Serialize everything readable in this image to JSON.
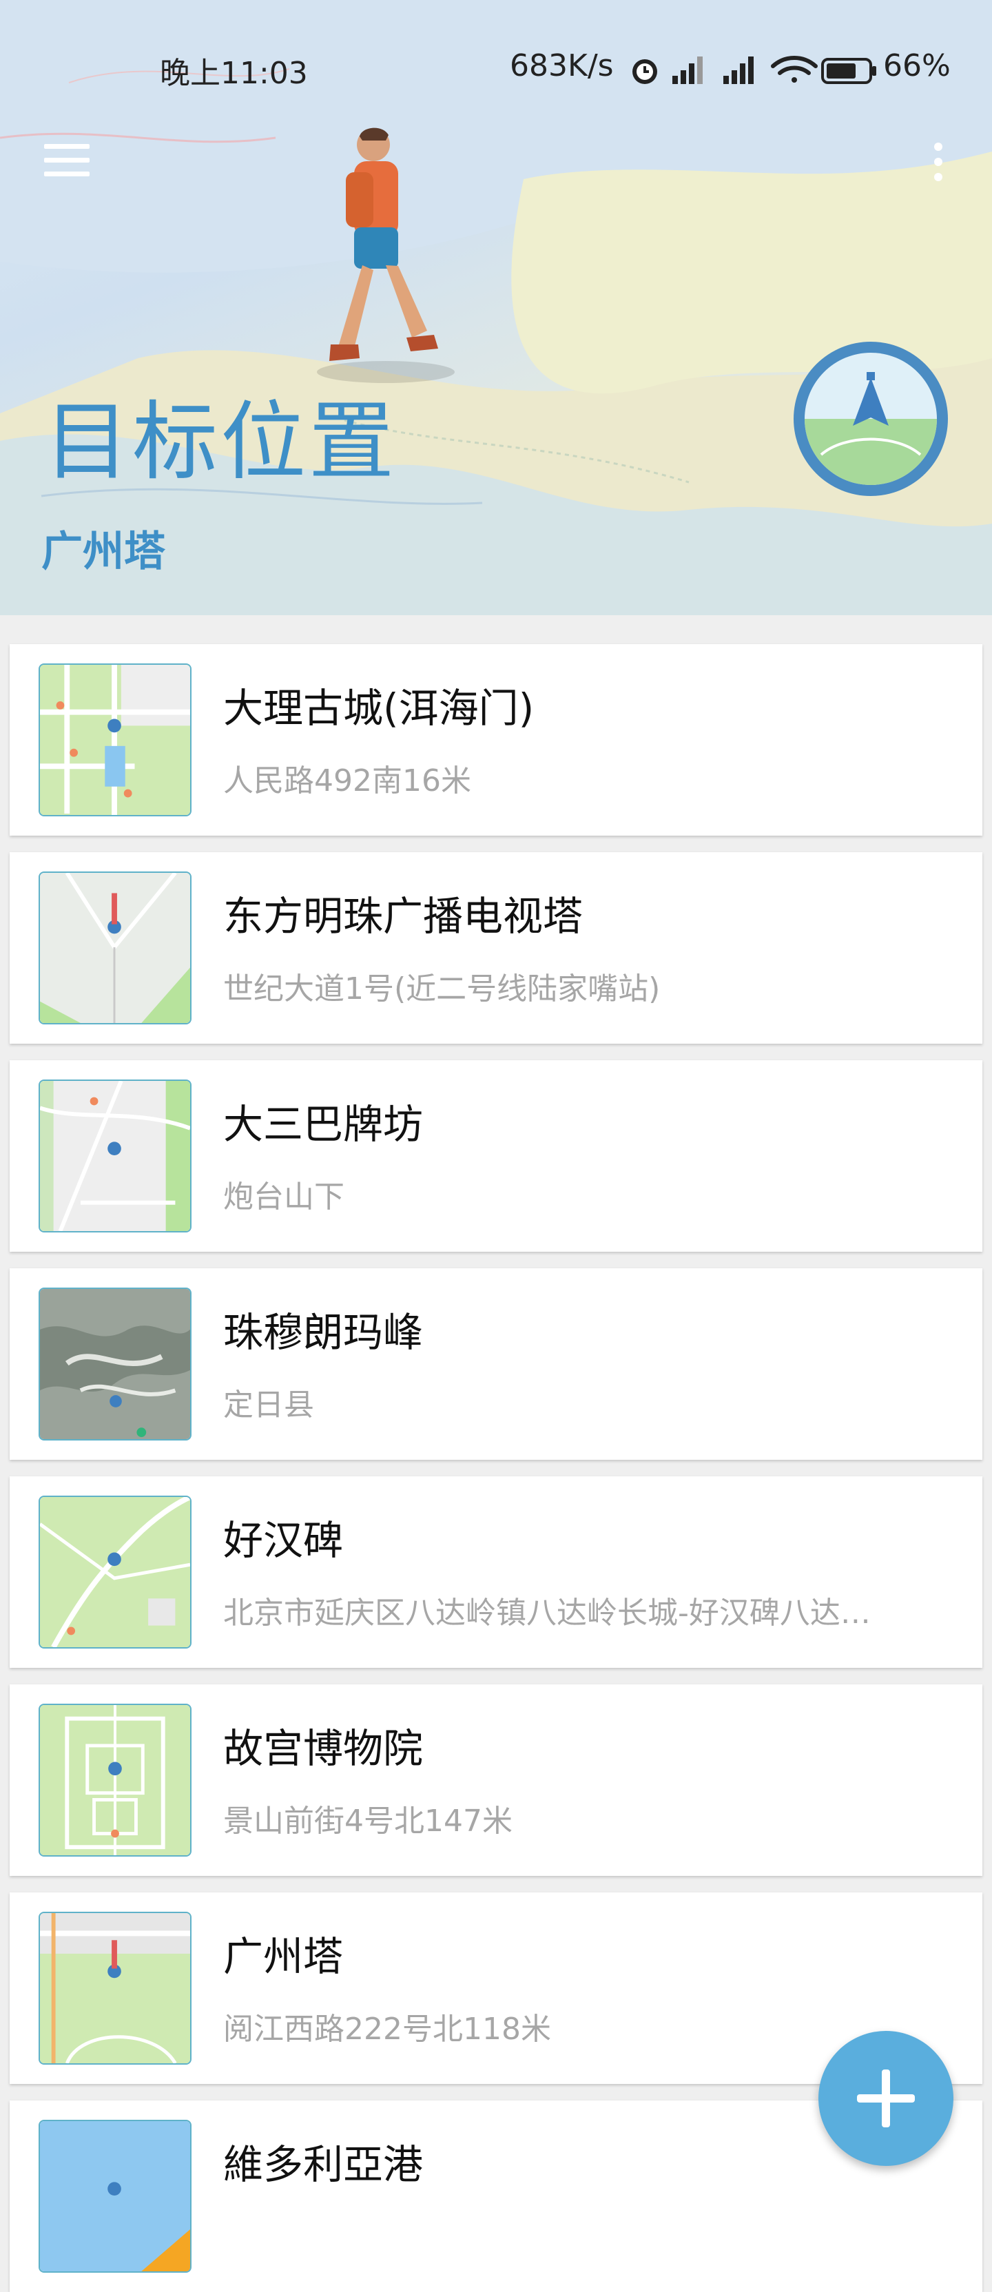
{
  "status_bar": {
    "time": "晚上11:03",
    "network_speed": "683K/s",
    "battery_percent": "66%"
  },
  "header": {
    "title": "目标位置",
    "subtitle": "广州塔",
    "menu_icon": "hamburger-menu-icon",
    "more_icon": "more-vertical-icon",
    "navigate_icon": "navigation-compass-icon",
    "accent_color": "#3e8fc7"
  },
  "places": [
    {
      "name": "大理古城(洱海门)",
      "address": "人民路492南16米"
    },
    {
      "name": "东方明珠广播电视塔",
      "address": "世纪大道1号(近二号线陆家嘴站)"
    },
    {
      "name": "大三巴牌坊",
      "address": "炮台山下"
    },
    {
      "name": "珠穆朗玛峰",
      "address": "定日县"
    },
    {
      "name": "好汉碑",
      "address": "北京市延庆区八达岭镇八达岭长城-好汉碑八达…"
    },
    {
      "name": "故宫博物院",
      "address": "景山前街4号北147米"
    },
    {
      "name": "广州塔",
      "address": "阅江西路222号北118米"
    },
    {
      "name": "維多利亞港",
      "address": ""
    }
  ],
  "fab": {
    "icon": "plus-icon",
    "color": "#5aaedd"
  }
}
